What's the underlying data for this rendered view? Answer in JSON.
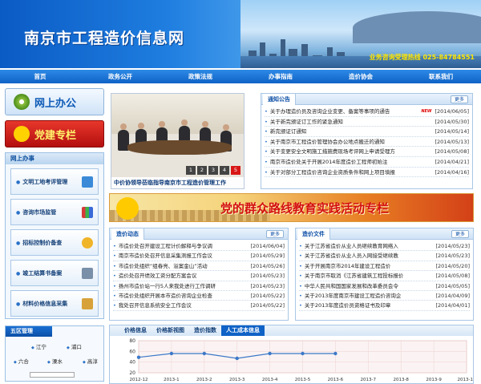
{
  "header": {
    "title": "南京市工程造价信息网",
    "hotline": "业务咨询受理热线 025-84784551"
  },
  "nav": [
    "首页",
    "政务公开",
    "政策法规",
    "办事指南",
    "造价协会",
    "联系我们"
  ],
  "left": {
    "online_office": "网上办公",
    "party_column": "党建专栏",
    "online_box_title": "网上办事",
    "services": [
      "文明工地考评管理",
      "咨询市场监管",
      "招标控制价备查",
      "竣工结算书备案",
      "材料价格信息采集"
    ]
  },
  "district": {
    "title": "五区管理",
    "items": [
      "江宁",
      "浦口",
      "六合",
      "溧水",
      "高淳"
    ]
  },
  "photo": {
    "caption": "中价协领导莅临指导南京市工程造价管理工作",
    "dots": [
      "1",
      "2",
      "3",
      "4",
      "5"
    ],
    "active_dot": 5
  },
  "notice": {
    "title": "通知公告",
    "more": "更多",
    "items": [
      {
        "t": "关于办理造价员及咨询企业变更、备案等事项的通告",
        "d": "[2014/06/05]",
        "new": true
      },
      {
        "t": "关于新完颁证订工作的紧急通知",
        "d": "[2014/05/30]"
      },
      {
        "t": "新完颁证订通知",
        "d": "[2014/05/14]"
      },
      {
        "t": "关于南京市工程造价管理协会办公地点搬迁的通知",
        "d": "[2014/05/13]"
      },
      {
        "t": "关于变更安全文明施工措施费现场考评网上申请受理方",
        "d": "[2014/05/08]"
      },
      {
        "t": "南京市造价处关于开展2014年度造价工程师初始注",
        "d": "[2014/04/21]"
      },
      {
        "t": "关于对部分工程造价咨询企业资质条件和网上项目填报",
        "d": "[2014/04/16]"
      }
    ]
  },
  "banner": {
    "text": "党的群众路线教育实践活动专栏"
  },
  "dynamics": {
    "title": "造价动态",
    "more": "更多",
    "items": [
      {
        "t": "市造价处召开建设工程计价解释与争议调",
        "d": "[2014/06/04]"
      },
      {
        "t": "南京市造价处召开信息采集测报工作会议",
        "d": "[2014/05/29]"
      },
      {
        "t": "市造价处组织“组春亮、溢案金山”活动",
        "d": "[2014/05/26]"
      },
      {
        "t": "造价处召开绩效工资分配方案会议",
        "d": "[2014/05/23]"
      },
      {
        "t": "扬州市造价站一行5人来我处进行工作调研",
        "d": "[2014/05/23]"
      },
      {
        "t": "市造价处组织开展本市造价咨询企业检查",
        "d": "[2014/05/22]"
      },
      {
        "t": "我处召开信息系统安全工作会议",
        "d": "[2014/05/22]"
      }
    ]
  },
  "documents": {
    "title": "造价文件",
    "more": "更多",
    "items": [
      {
        "t": "关于江苏省造价从业人员继续教育网络入",
        "d": "[2014/05/23]"
      },
      {
        "t": "关于江苏省造价从业人员入网接受继续教",
        "d": "[2014/05/23]"
      },
      {
        "t": "关于开展南京市2014年建设工程造价",
        "d": "[2014/05/20]"
      },
      {
        "t": "关于南京市取消《江苏省建筑工程投标报价",
        "d": "[2014/05/08]"
      },
      {
        "t": "中华人民共和国国家发展和改革委员会令",
        "d": "[2014/05/05]"
      },
      {
        "t": "关于2013年度南京市建设工程造价咨询企",
        "d": "[2014/04/09]"
      },
      {
        "t": "关于2013年度造价员资格证书及印章",
        "d": "[2014/04/01]"
      }
    ]
  },
  "price": {
    "tabs": [
      "价格信息",
      "价格新视图",
      "造价指数",
      "人工成本信息"
    ],
    "active_tab": 3
  },
  "chart_data": {
    "type": "line",
    "x": [
      "2012-12",
      "2013-1",
      "2013-2",
      "2013-3",
      "2013-4",
      "2013-5",
      "2013-6",
      "2013-7",
      "2013-8",
      "2013-9",
      "2013-10"
    ],
    "series": [
      {
        "values": [
          49,
          56,
          56,
          47,
          56,
          56,
          56
        ]
      }
    ],
    "ylim": [
      20,
      60
    ],
    "yticks": [
      20,
      40,
      60,
      80
    ],
    "grid": true,
    "color": "#3b78c8"
  }
}
